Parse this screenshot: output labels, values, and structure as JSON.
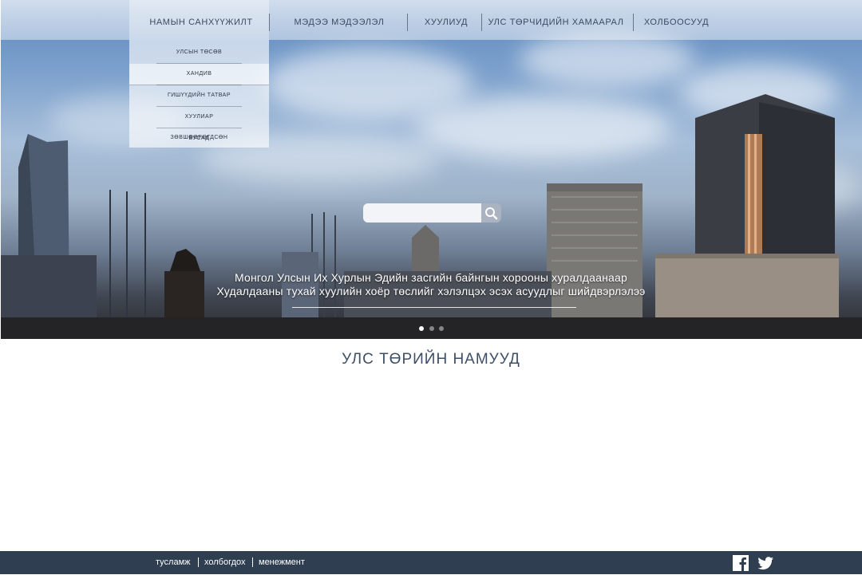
{
  "nav": {
    "items": [
      {
        "label": "НАМЫН САНХҮҮЖИЛТ"
      },
      {
        "label": "МЭДЭЭ МЭДЭЭЛЭЛ"
      },
      {
        "label": "ХУУЛИУД"
      },
      {
        "label": "УЛС ТӨРЧИДИЙН ХАМААРАЛ"
      },
      {
        "label": "ХОЛБООСУУД"
      }
    ],
    "dropdown": [
      {
        "label": "УЛСЫН ТӨСӨВ"
      },
      {
        "label": "ХАНДИВ"
      },
      {
        "label": "ГИШҮҮДИЙН ТАТВАР"
      },
      {
        "label": "ХУУЛИАР ЗӨВШӨӨРӨГДСӨН"
      },
      {
        "label": "БУСАД"
      }
    ]
  },
  "search": {
    "placeholder": "",
    "icon": "search-icon"
  },
  "slider": {
    "caption_line1": "Монгол Улсын Их Хурлын Эдийн засгийн байнгын хорооны хуралдаанаар",
    "caption_line2": "Худалдааны тухай хуулийн хоёр төслийг хэлэлцэх эсэх асуудлыг шийдвэрлэлээ",
    "dots": 3,
    "active_dot": 1
  },
  "section": {
    "title": "УЛС ТӨРИЙН НАМУУД"
  },
  "footer": {
    "links": [
      {
        "label": "тусламж"
      },
      {
        "label": "холбогдох"
      },
      {
        "label": "менежмент"
      }
    ],
    "social": [
      "facebook-icon",
      "twitter-icon"
    ]
  },
  "colors": {
    "footer_bg": "#2f3e50",
    "nav_text": "#3c4a5e",
    "title_text": "#3d4f66"
  }
}
